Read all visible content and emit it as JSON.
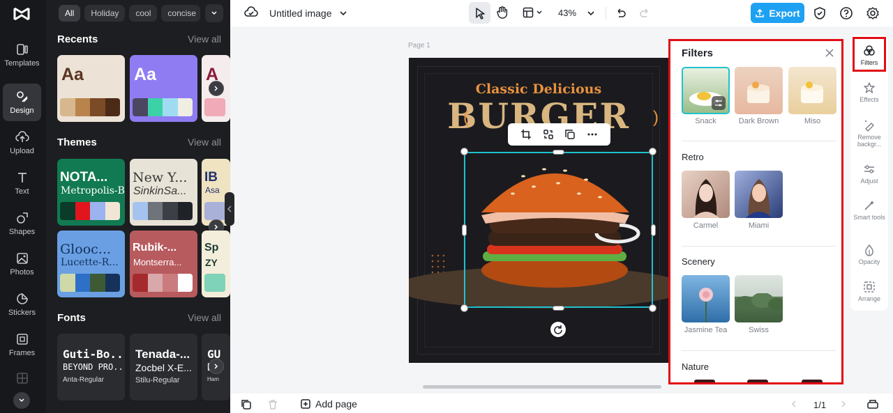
{
  "rail": {
    "items": [
      {
        "label": "Templates",
        "icon": "templates-icon"
      },
      {
        "label": "Design",
        "icon": "design-icon",
        "active": true
      },
      {
        "label": "Upload",
        "icon": "upload-icon"
      },
      {
        "label": "Text",
        "icon": "text-icon"
      },
      {
        "label": "Shapes",
        "icon": "shapes-icon"
      },
      {
        "label": "Photos",
        "icon": "photos-icon"
      },
      {
        "label": "Stickers",
        "icon": "stickers-icon"
      },
      {
        "label": "Frames",
        "icon": "frames-icon"
      }
    ]
  },
  "design_panel": {
    "chips": [
      "All",
      "Holiday",
      "cool",
      "concise"
    ],
    "recents": {
      "title": "Recents",
      "view_all": "View all",
      "cards": [
        {
          "text": "Aa",
          "bg": "#ece2d6",
          "color": "#5a3420",
          "swatches": [
            "#d7b88e",
            "#b9844b",
            "#7b4a27",
            "#4b2a17"
          ]
        },
        {
          "text": "Aa",
          "bg": "#8f7cf2",
          "color": "#ffffff",
          "swatches": [
            "#4b4760",
            "#3cd2a8",
            "#9fdcf1",
            "#f0eee2"
          ]
        },
        {
          "text": "A",
          "bg": "#f5eded",
          "color": "#8a1d3a",
          "swatches": [
            "#f0aab8",
            "#e98ea0"
          ]
        }
      ]
    },
    "themes": {
      "title": "Themes",
      "view_all": "View all",
      "cards": [
        {
          "t1": "NOTA...",
          "t2": "Metropolis-B...",
          "bg": "#117a52",
          "color": "#ffffff",
          "swatches": [
            "#0b3b29",
            "#e0151e",
            "#9bb3ef",
            "#f1e6d6"
          ]
        },
        {
          "t1": "New Y...",
          "t2": "SinkinSa...",
          "bg": "#e8e3d7",
          "color": "#3a3a3a",
          "swatches": [
            "#a4c4ef",
            "#6f737a",
            "#3c3f45",
            "#1f2226"
          ]
        },
        {
          "t1": "IB",
          "t2": "Asa",
          "bg": "#f0e3c2",
          "color": "#22316b",
          "swatches": [
            "#a9b1d8"
          ]
        },
        {
          "t1": "Glooc...",
          "t2": "Lucette-R...",
          "bg": "#6aa0e3",
          "color": "#12305e",
          "swatches": [
            "#cfd9a8",
            "#2e6fc7",
            "#3d5a35",
            "#17325a"
          ]
        },
        {
          "t1": "Rubik-...",
          "t2": "Montserra...",
          "bg": "#b85b5f",
          "color": "#ffffff",
          "swatches": [
            "#a52a2e",
            "#d9a8aa",
            "#c97b7e",
            "#ffffff"
          ]
        },
        {
          "t1": "Sp",
          "t2": "ZY",
          "bg": "#f3eedb",
          "color": "#1d3a34",
          "swatches": [
            "#7fd3b8"
          ]
        }
      ]
    },
    "fonts": {
      "title": "Fonts",
      "view_all": "View all",
      "cards": [
        {
          "f1": "Guti-Bo...",
          "f2": "BEYOND PRO...",
          "f3": "Anta-Regular"
        },
        {
          "f1": "Tenada-...",
          "f2": "Zocbel X-E...",
          "f3": "Stilu-Regular"
        },
        {
          "f1": "GU",
          "f2": "D",
          "f3": "Ham"
        }
      ]
    }
  },
  "topbar": {
    "doc_title": "Untitled image",
    "zoom": "43%",
    "export_label": "Export"
  },
  "canvas": {
    "page_label": "Page 1",
    "art_subtitle": "Classic Delicious",
    "art_title": "BURGER"
  },
  "bottombar": {
    "add_page": "Add page",
    "pager": "1/1"
  },
  "filters": {
    "title": "Filters",
    "top_row": [
      {
        "label": "Snack",
        "colors": [
          "#e9f0e0",
          "#9bbd8a"
        ],
        "selected": true
      },
      {
        "label": "Dark Brown",
        "colors": [
          "#ecd2c0",
          "#e7b8a0"
        ]
      },
      {
        "label": "Miso",
        "colors": [
          "#f3e6cf",
          "#e9cf9c"
        ]
      }
    ],
    "sections": [
      {
        "title": "Retro",
        "items": [
          {
            "label": "Carmel",
            "colors": [
              "#e8d1c4",
              "#5b3b33"
            ]
          },
          {
            "label": "Miami",
            "colors": [
              "#7a8ec6",
              "#2a3d78"
            ]
          }
        ]
      },
      {
        "title": "Scenery",
        "items": [
          {
            "label": "Jasmine Tea",
            "colors": [
              "#6aa6d6",
              "#2e6ea8"
            ]
          },
          {
            "label": "Swiss",
            "colors": [
              "#c9d4cc",
              "#5a7a55"
            ]
          }
        ]
      },
      {
        "title": "Nature",
        "items": []
      }
    ]
  },
  "right_tools": [
    {
      "label": "Filters",
      "icon": "filters-icon",
      "active": true
    },
    {
      "label": "Effects",
      "icon": "effects-icon"
    },
    {
      "label": "Remove backgr...",
      "icon": "remove-background-icon"
    },
    {
      "label": "Adjust",
      "icon": "adjust-icon"
    },
    {
      "label": "Smart tools",
      "icon": "smart-tools-icon"
    },
    {
      "label": "Opacity",
      "icon": "opacity-icon"
    },
    {
      "label": "Arrange",
      "icon": "arrange-icon"
    }
  ]
}
